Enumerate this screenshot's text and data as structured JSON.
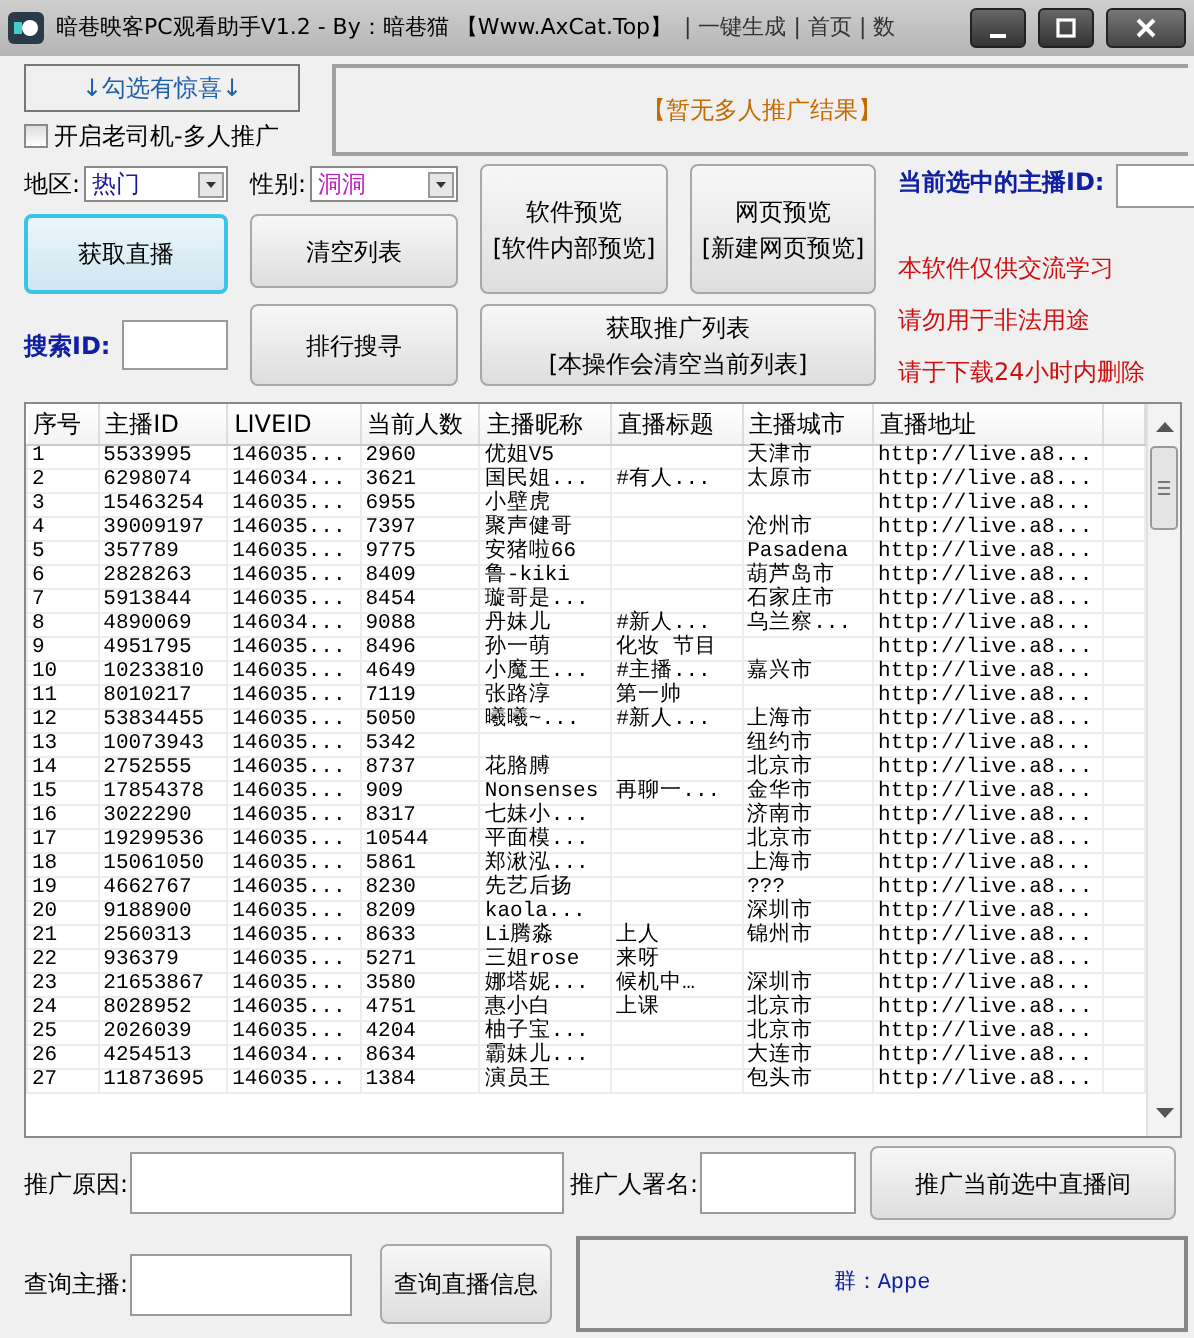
{
  "window": {
    "title": "暗巷映客PC观看助手V1.2  - By：暗巷猫 【Www.AxCat.Top】",
    "background_text": "| 一键生成 | 首页 | 数"
  },
  "surprise_button": "↓勾选有惊喜↓",
  "multi_promo": {
    "label": "开启老司机-多人推广",
    "checked": false
  },
  "promo_result": "【暂无多人推广结果】",
  "filters": [
    {
      "label": "地区:",
      "value": "热门"
    },
    {
      "label": "性别:",
      "value": "洞洞"
    }
  ],
  "get_live_button": "获取直播",
  "clear_list_button": "清空列表",
  "preview_buttons": [
    {
      "title": "软件预览",
      "subtitle": "[软件内部预览]"
    },
    {
      "title": "网页预览",
      "subtitle": "[新建网页预览]"
    }
  ],
  "selected_anchor": {
    "label": "当前选中的主播ID:"
  },
  "notices": [
    "本软件仅供交流学习",
    "请勿用于非法用途",
    "请于下载24小时内删除"
  ],
  "search": {
    "label": "搜索ID:"
  },
  "rank_search_button": "排行搜寻",
  "promo_list_button": {
    "title": "获取推广列表",
    "subtitle": "[本操作会清空当前列表]"
  },
  "table": {
    "columns": [
      "序号",
      "主播ID",
      "LIVEID",
      "当前人数",
      "主播昵称",
      "直播标题",
      "主播城市",
      "直播地址"
    ],
    "rows": [
      [
        "1",
        "5533995",
        "146035...",
        "2960",
        "优姐V5",
        "",
        "天津市",
        "http://live.a8..."
      ],
      [
        "2",
        "6298074",
        "146034...",
        "3621",
        "国民姐...",
        "#有人...",
        "太原市",
        "http://live.a8..."
      ],
      [
        "3",
        "15463254",
        "146035...",
        "6955",
        "小壁虎",
        "",
        "",
        "http://live.a8..."
      ],
      [
        "4",
        "39009197",
        "146035...",
        "7397",
        "聚声健哥",
        "",
        "沧州市",
        "http://live.a8..."
      ],
      [
        "5",
        "357789",
        "146035...",
        "9775",
        "安猪啦66",
        "",
        "Pasadena",
        "http://live.a8..."
      ],
      [
        "6",
        "2828263",
        "146035...",
        "8409",
        "鲁-kiki",
        "",
        "葫芦岛市",
        "http://live.a8..."
      ],
      [
        "7",
        "5913844",
        "146035...",
        "8454",
        "璇哥是...",
        "",
        "石家庄市",
        "http://live.a8..."
      ],
      [
        "8",
        "4890069",
        "146034...",
        "9088",
        "丹妹儿",
        "#新人...",
        "乌兰察...",
        "http://live.a8..."
      ],
      [
        "9",
        "4951795",
        "146035...",
        "8496",
        "孙一萌",
        "化妆 节目",
        "",
        "http://live.a8..."
      ],
      [
        "10",
        "10233810",
        "146035...",
        "4649",
        "小魔王...",
        "#主播...",
        "嘉兴市",
        "http://live.a8..."
      ],
      [
        "11",
        "8010217",
        "146035...",
        "7119",
        "张路淳",
        "第一帅",
        "",
        "http://live.a8..."
      ],
      [
        "12",
        "53834455",
        "146035...",
        "5050",
        "曦曦~...",
        "#新人...",
        "上海市",
        "http://live.a8..."
      ],
      [
        "13",
        "10073943",
        "146035...",
        "5342",
        "",
        "",
        "纽约市",
        "http://live.a8..."
      ],
      [
        "14",
        "2752555",
        "146035...",
        "8737",
        "花胳膊",
        "",
        "北京市",
        "http://live.a8..."
      ],
      [
        "15",
        "17854378",
        "146035...",
        "909",
        "Nonsenses",
        "再聊一...",
        "金华市",
        "http://live.a8..."
      ],
      [
        "16",
        "3022290",
        "146035...",
        "8317",
        "七妹小...",
        "",
        "济南市",
        "http://live.a8..."
      ],
      [
        "17",
        "19299536",
        "146035...",
        "10544",
        "平面模...",
        "",
        "北京市",
        "http://live.a8..."
      ],
      [
        "18",
        "15061050",
        "146035...",
        "5861",
        "郑湫泓...",
        "",
        "上海市",
        "http://live.a8..."
      ],
      [
        "19",
        "4662767",
        "146035...",
        "8230",
        "先艺后扬",
        "",
        "???",
        "http://live.a8..."
      ],
      [
        "20",
        "9188900",
        "146035...",
        "8209",
        "kaola...",
        "",
        "深圳市",
        "http://live.a8..."
      ],
      [
        "21",
        "2560313",
        "146035...",
        "8633",
        "Li腾淼",
        "上人",
        "锦州市",
        "http://live.a8..."
      ],
      [
        "22",
        "936379",
        "146035...",
        "5271",
        "三姐rose",
        "来呀",
        "",
        "http://live.a8..."
      ],
      [
        "23",
        "21653867",
        "146035...",
        "3580",
        "娜塔妮...",
        "候机中…",
        "深圳市",
        "http://live.a8..."
      ],
      [
        "24",
        "8028952",
        "146035...",
        "4751",
        "惠小白",
        "上课",
        "北京市",
        "http://live.a8..."
      ],
      [
        "25",
        "2026039",
        "146035...",
        "4204",
        "柚子宝...",
        "",
        "北京市",
        "http://live.a8..."
      ],
      [
        "26",
        "4254513",
        "146034...",
        "8634",
        "霸妹儿...",
        "",
        "大连市",
        "http://live.a8..."
      ],
      [
        "27",
        "11873695",
        "146035...",
        "1384",
        "演员王",
        "",
        "包头市",
        "http://live.a8..."
      ]
    ]
  },
  "promo_reason": {
    "label": "推广原因:"
  },
  "promoter": {
    "label": "推广人署名:"
  },
  "promote_button": "推广当前选中直播间",
  "query_anchor": {
    "label": "查询主播:"
  },
  "query_button": "查询直播信息",
  "group_info": "群：Appe"
}
